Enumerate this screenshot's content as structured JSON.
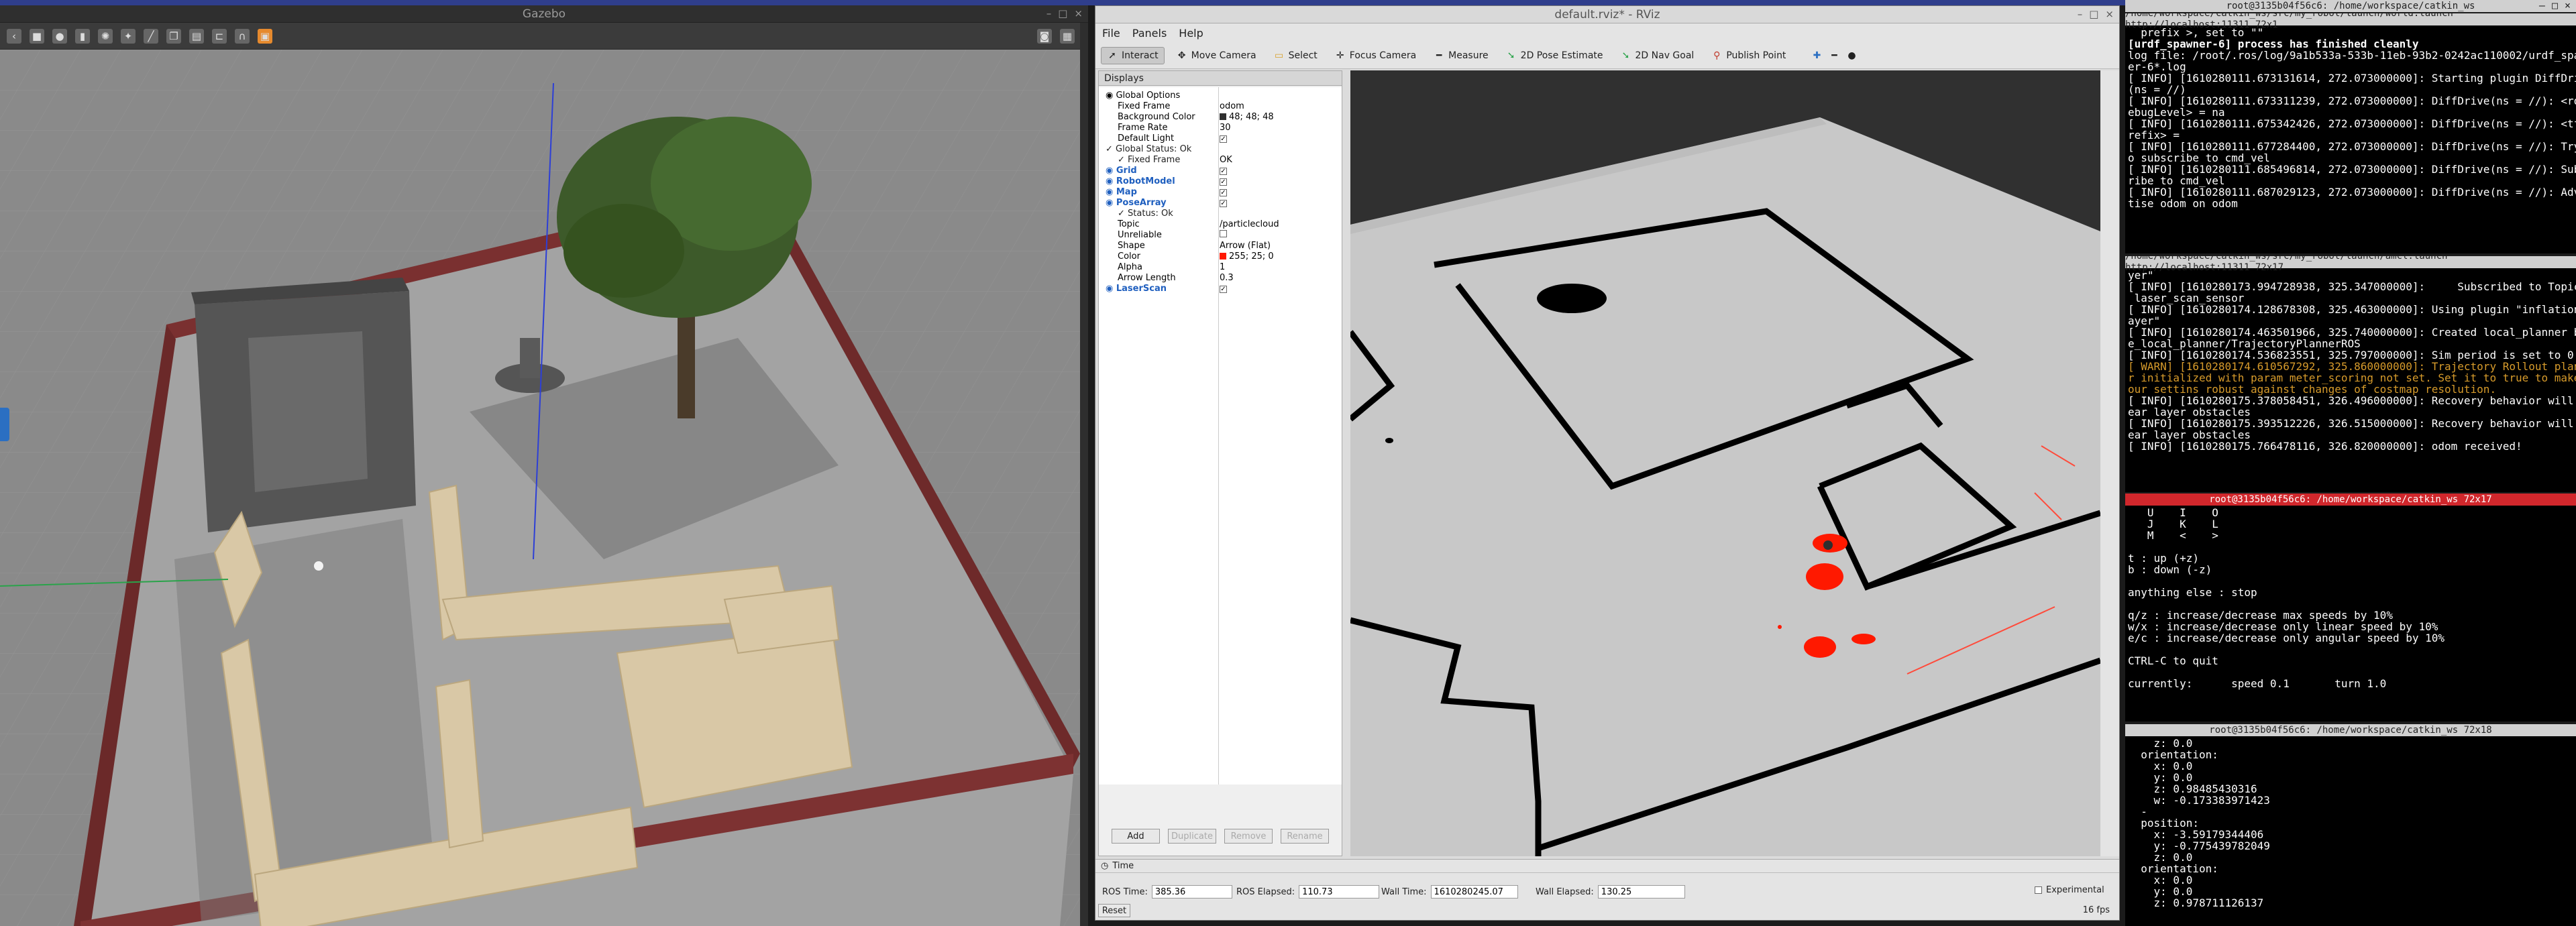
{
  "top_bar": {
    "color": "#2f3e8c"
  },
  "gazebo": {
    "title": "Gazebo",
    "controls": [
      "–",
      "□",
      "×"
    ]
  },
  "rviz": {
    "title": "default.rviz* - RViz",
    "controls": [
      "–",
      "□",
      "×"
    ],
    "menu": [
      "File",
      "Panels",
      "Help"
    ],
    "tools": [
      {
        "label": "Interact",
        "icon": "cursor-icon"
      },
      {
        "label": "Move Camera",
        "icon": "move-camera-icon"
      },
      {
        "label": "Select",
        "icon": "select-icon"
      },
      {
        "label": "Focus Camera",
        "icon": "focus-camera-icon"
      },
      {
        "label": "Measure",
        "icon": "measure-icon"
      },
      {
        "label": "2D Pose Estimate",
        "icon": "pose-estimate-icon"
      },
      {
        "label": "2D Nav Goal",
        "icon": "nav-goal-icon"
      },
      {
        "label": "Publish Point",
        "icon": "publish-point-icon"
      }
    ],
    "displays_title": "Displays",
    "displays": [
      {
        "label": "Global Options",
        "value": "",
        "indent": 1,
        "type": "group"
      },
      {
        "label": "Fixed Frame",
        "value": "odom",
        "indent": 2
      },
      {
        "label": "Background Color",
        "value": "48; 48; 48",
        "indent": 2,
        "swatch": "#303030"
      },
      {
        "label": "Frame Rate",
        "value": "30",
        "indent": 2
      },
      {
        "label": "Default Light",
        "value": "✓",
        "indent": 2,
        "check": true
      },
      {
        "label": "Global Status: Ok",
        "value": "",
        "indent": 1,
        "type": "status"
      },
      {
        "label": "Fixed Frame",
        "value": "OK",
        "indent": 2,
        "type": "status"
      },
      {
        "label": "Grid",
        "value": "✓",
        "indent": 1,
        "type": "display",
        "check": true
      },
      {
        "label": "RobotModel",
        "value": "✓",
        "indent": 1,
        "type": "display",
        "check": true
      },
      {
        "label": "Map",
        "value": "✓",
        "indent": 1,
        "type": "display",
        "check": true
      },
      {
        "label": "PoseArray",
        "value": "✓",
        "indent": 1,
        "type": "display",
        "check": true
      },
      {
        "label": "Status: Ok",
        "value": "",
        "indent": 2,
        "type": "status"
      },
      {
        "label": "Topic",
        "value": "/particlecloud",
        "indent": 2
      },
      {
        "label": "Unreliable",
        "value": "",
        "indent": 2,
        "check": true,
        "unchecked": true
      },
      {
        "label": "Shape",
        "value": "Arrow (Flat)",
        "indent": 2
      },
      {
        "label": "Color",
        "value": "255; 25; 0",
        "indent": 2,
        "swatch": "#ff1900"
      },
      {
        "label": "Alpha",
        "value": "1",
        "indent": 2
      },
      {
        "label": "Arrow Length",
        "value": "0.3",
        "indent": 2
      },
      {
        "label": "LaserScan",
        "value": "✓",
        "indent": 1,
        "type": "display",
        "check": true
      }
    ],
    "panel_buttons": [
      "Add",
      "Duplicate",
      "Remove",
      "Rename"
    ],
    "time": {
      "title": "Time",
      "ros_time_label": "ROS Time:",
      "ros_time": "385.36",
      "ros_elapsed_label": "ROS Elapsed:",
      "ros_elapsed": "110.73",
      "wall_time_label": "Wall Time:",
      "wall_time": "1610280245.07",
      "wall_elapsed_label": "Wall Elapsed:",
      "wall_elapsed": "130.25",
      "experimental": "Experimental",
      "reset": "Reset",
      "fps": "16 fps"
    }
  },
  "terminals": [
    {
      "title": "/home/workspace/catkin_ws/src/my_robot/launch/world.launch http://localhost:11311 72x1",
      "lines": [
        "  prefix >, set to \"\"",
        "[urdf_spawner-6] process has finished cleanly",
        "log file: /root/.ros/log/9a1b533a-533b-11eb-93b2-0242ac110002/urdf_spawn",
        "er-6*.log",
        "[ INFO] [1610280111.673131614, 272.073000000]: Starting plugin DiffDrive",
        "(ns = //)",
        "[ INFO] [1610280111.673311239, 272.073000000]: DiffDrive(ns = //): <rosD",
        "ebugLevel> = na",
        "[ INFO] [1610280111.675342426, 272.073000000]: DiffDrive(ns = //): <tf_p",
        "refix> =",
        "[ INFO] [1610280111.677284400, 272.073000000]: DiffDrive(ns = //): Try t",
        "o subscribe to cmd_vel",
        "[ INFO] [1610280111.685496814, 272.073000000]: DiffDrive(ns = //): Subsc",
        "ribe to cmd_vel",
        "[ INFO] [1610280111.687029123, 272.073000000]: DiffDrive(ns = //): Adver",
        "tise odom on odom"
      ]
    },
    {
      "title": "/home/workspace/catkin_ws/src/my_robot/launch/amcl.launch http://localhost:11311 72x17",
      "lines": [
        "yer\"",
        "[ INFO] [1610280173.994728938, 325.347000000]:     Subscribed to Topics:",
        " laser_scan_sensor",
        "[ INFO] [1610280174.128678308, 325.463000000]: Using plugin \"inflation_l",
        "ayer\"",
        "[ INFO] [1610280174.463501966, 325.740000000]: Created local_planner bas",
        "e_local_planner/TrajectoryPlannerROS",
        "[ INFO] [1610280174.536823551, 325.797000000]: Sim period is set to 0.10",
        "[ WARN] [1610280174.610567292, 325.860000000]: Trajectory Rollout planne",
        "r initialized with param meter_scoring not set. Set it to true to make y",
        "our settins robust against changes of costmap resolution.",
        "[ INFO] [1610280175.378058451, 326.496000000]: Recovery behavior will cl",
        "ear layer obstacles",
        "[ INFO] [1610280175.393512226, 326.515000000]: Recovery behavior will cl",
        "ear layer obstacles",
        "[ INFO] [1610280175.766478116, 326.820000000]: odom received!"
      ],
      "warn_lines": [
        8,
        9,
        10
      ]
    },
    {
      "title": "root@3135b04f56c6: /home/workspace/catkin_ws 72x17",
      "lines": [
        "   U    I    O",
        "   J    K    L",
        "   M    <    >",
        "",
        "t : up (+z)",
        "b : down (-z)",
        "",
        "anything else : stop",
        "",
        "q/z : increase/decrease max speeds by 10%",
        "w/x : increase/decrease only linear speed by 10%",
        "e/c : increase/decrease only angular speed by 10%",
        "",
        "CTRL-C to quit",
        "",
        "currently:      speed 0.1       turn 1.0"
      ]
    },
    {
      "title": "root@3135b04f56c6: /home/workspace/catkin_ws 72x18",
      "lines": [
        "    z: 0.0",
        "  orientation:",
        "    x: 0.0",
        "    y: 0.0",
        "    z: 0.98485430316",
        "    w: -0.173383971423",
        "  -",
        "  position:",
        "    x: -3.59179344406",
        "    y: -0.775439782049",
        "    z: 0.0",
        "  orientation:",
        "    x: 0.0",
        "    y: 0.0",
        "    z: 0.978711126137"
      ]
    },
    {
      "title": "root@3135b04f56c6: /home/workspace/catkin_ws",
      "controls": [
        "–",
        "□",
        "×"
      ]
    }
  ]
}
